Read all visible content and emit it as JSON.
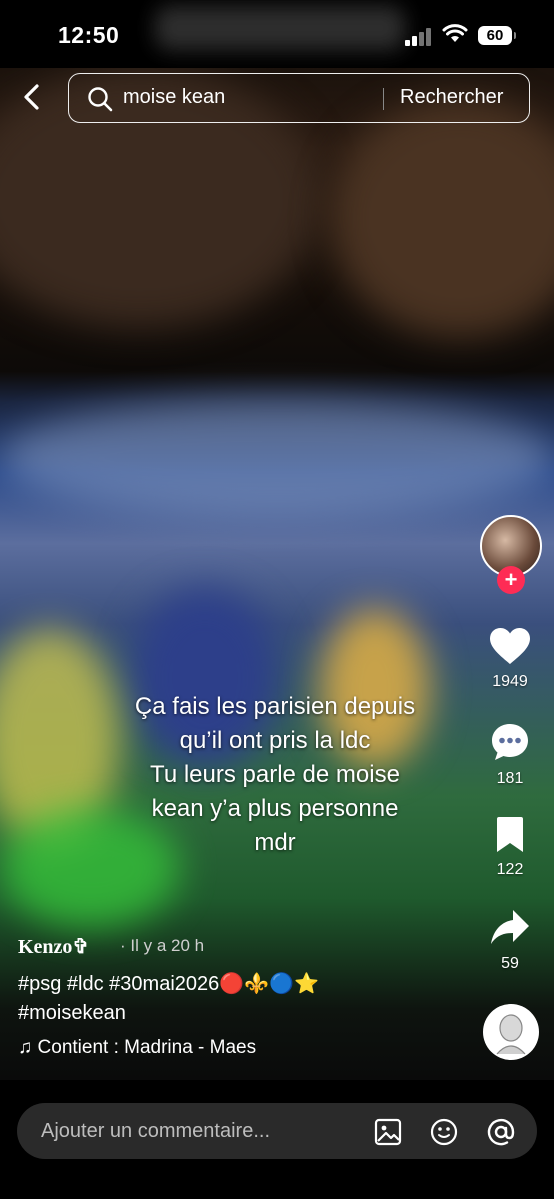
{
  "status": {
    "time": "12:50",
    "battery": "60"
  },
  "search": {
    "query": "moise kean",
    "button": "Rechercher"
  },
  "caption": "Ça fais les parisien depuis\nqu’il ont pris la ldc\nTu leurs parle de moise\nkean y’a plus personne\nmdr",
  "actions": {
    "likes": "1949",
    "comments": "181",
    "saves": "122",
    "shares": "59"
  },
  "post": {
    "username": "Kenzo✞",
    "time_ago": "· Il y a 20 h",
    "description": "#psg #ldc #30mai2026🔴⚜️🔵⭐\n#moisekean",
    "music": "Contient : Madrina - Maes"
  },
  "comment_bar": {
    "placeholder": "Ajouter un commentaire..."
  },
  "colors": {
    "follow": "#fe2c55",
    "accent_white": "#ffffff"
  },
  "icons": [
    "back-icon",
    "search-icon",
    "heart-icon",
    "comment-icon",
    "bookmark-icon",
    "share-icon",
    "image-icon",
    "emoji-icon",
    "mention-icon",
    "music-note-icon"
  ]
}
